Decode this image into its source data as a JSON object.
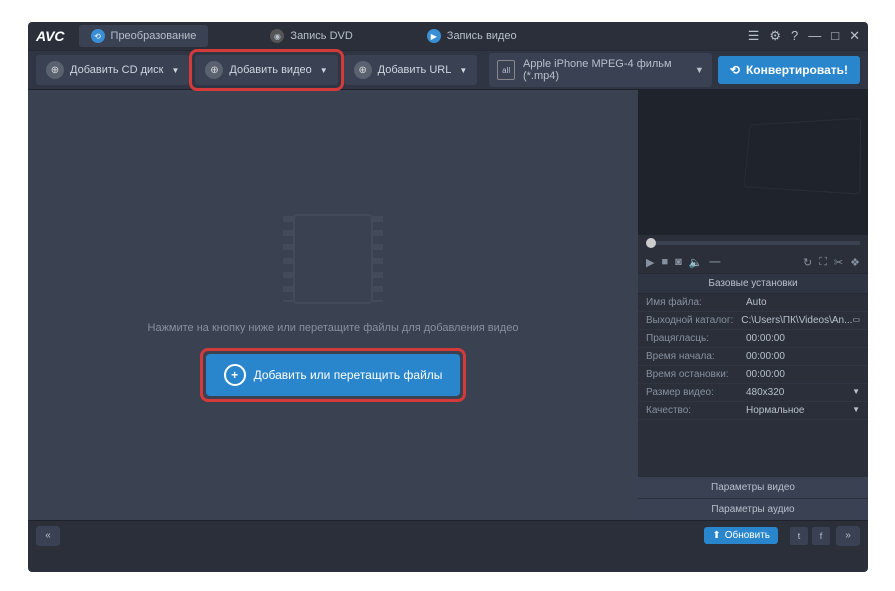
{
  "logo": "AVC",
  "tabs": {
    "convert": "Преобразование",
    "dvd": "Запись DVD",
    "rec": "Запись видео"
  },
  "winbtns": {
    "menu": "☰",
    "gear": "⚙",
    "help": "?",
    "min": "—",
    "max": "□",
    "close": "✕"
  },
  "toolbar": {
    "add_cd": "Добавить CD диск",
    "add_video": "Добавить видео",
    "add_url": "Добавить URL",
    "format": "Apple iPhone MPEG-4 фильм (*.mp4)",
    "convert": "Конвертировать!"
  },
  "main": {
    "hint": "Нажмите на кнопку ниже или перетащите файлы для добавления видео",
    "add_btn": "Добавить или перетащить файлы"
  },
  "side": {
    "basic_header": "Базовые установки",
    "props": {
      "filename_l": "Имя файла:",
      "filename_v": "Auto",
      "outdir_l": "Выходной каталог:",
      "outdir_v": "C:\\Users\\ПК\\Videos\\An...",
      "dur_l": "Працягласць:",
      "dur_v": "00:00:00",
      "start_l": "Время начала:",
      "start_v": "00:00:00",
      "stop_l": "Время остановки:",
      "stop_v": "00:00:00",
      "size_l": "Размер видео:",
      "size_v": "480x320",
      "qual_l": "Качество:",
      "qual_v": "Нормальное"
    },
    "video_params": "Параметры видео",
    "audio_params": "Параметры аудио"
  },
  "bottom": {
    "update": "Обновить"
  }
}
